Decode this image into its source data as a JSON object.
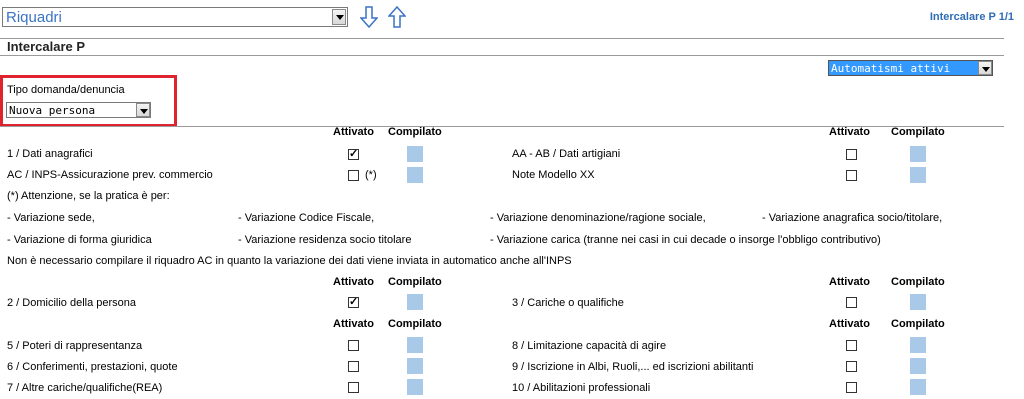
{
  "header": {
    "section_select": "Riquadri",
    "page_indicator": "Intercalare P 1/1",
    "form_title": "Intercalare P"
  },
  "automatismi": "Automatismi attivi",
  "tipo": {
    "label": "Tipo domanda/denuncia",
    "value": "Nuova persona"
  },
  "cols": {
    "attivato": "Attivato",
    "compilato": "Compilato"
  },
  "rows": {
    "r1l": "1 / Dati anagrafici",
    "r1r": "AA - AB / Dati artigiani",
    "r2l": "AC / INPS-Assicurazione prev. commercio",
    "r2note": "(*)",
    "r2r": "Note Modello XX",
    "r3l": "2 / Domicilio della persona",
    "r3r": "3 / Cariche o qualifiche",
    "r4l": "5 / Poteri di rappresentanza",
    "r4r": "8 / Limitazione capacità di agire",
    "r5l": "6 / Conferimenti, prestazioni, quote",
    "r5r": "9 / Iscrizione in Albi, Ruoli,... ed iscrizioni abilitanti",
    "r6l": "7 / Altre cariche/qualifiche(REA)",
    "r6r": "10 / Abilitazioni professionali"
  },
  "note": {
    "intro": "(*) Attenzione, se la pratica è per:",
    "v1": "- Variazione sede,",
    "v2": "- Variazione Codice Fiscale,",
    "v3": "- Variazione denominazione/ragione sociale,",
    "v4": "- Variazione anagrafica socio/titolare,",
    "v5": "- Variazione di forma giuridica",
    "v6": "- Variazione residenza socio titolare",
    "v7": "- Variazione carica (tranne nei casi in cui decade o insorge l'obbligo contributivo)",
    "conclusion": "Non è necessario compilare il riquadro AC in quanto la variazione dei dati viene inviata in automatico anche all'INPS"
  },
  "checked": {
    "r1l": true,
    "r3l": true
  }
}
